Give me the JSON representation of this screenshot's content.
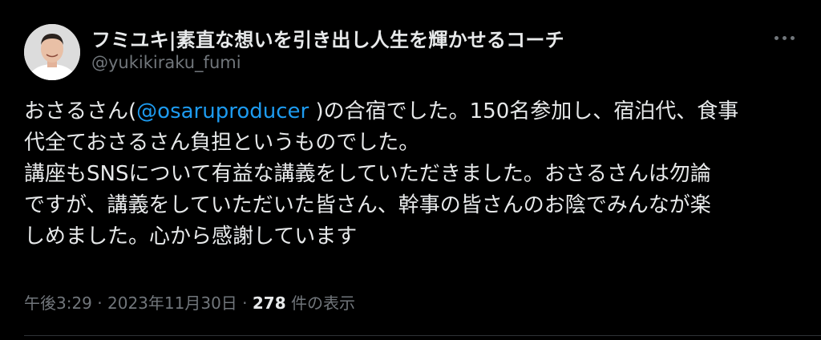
{
  "author": {
    "display_name": "フミユキ|素直な想いを引き出し人生を輝かせるコーチ",
    "handle": "@yukikiraku_fumi"
  },
  "more_icon": "more-horizontal-icon",
  "body": {
    "line1_a": "おさるさん(",
    "line1_mention": "@osaruproducer",
    "line1_b": " )の合宿でした。150名参加し、宿泊代、食事",
    "line2": "代全ておさるさん負担というものでした。",
    "line3": "講座もSNSについて有益な講義をしていただきました。おさるさんは勿論",
    "line4": "ですが、講義をしていただいた皆さん、幹事の皆さんのお陰でみんなが楽",
    "line5": "しめました。心から感謝しています"
  },
  "meta": {
    "time": "午後3:29",
    "separator1": " · ",
    "date": "2023年11月30日",
    "separator2": " · ",
    "view_count": "278",
    "view_label": " 件の表示"
  },
  "colors": {
    "background": "#000000",
    "text": "#e7e9ea",
    "secondary": "#71767b",
    "link": "#1d9bf0"
  }
}
